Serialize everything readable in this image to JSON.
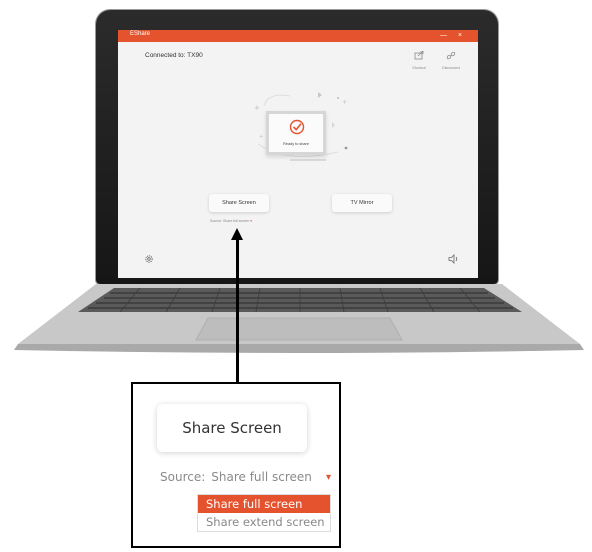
{
  "app": {
    "title": "EShare",
    "minimize": "—",
    "close": "×",
    "connected": "Connected to: TX90",
    "shortcut_label": "Shortcut",
    "disconnect_label": "Disconnect",
    "status": "Ready to share",
    "share_button": "Share Screen",
    "tv_mirror_button": "TV Mirror",
    "source_label": "Source:",
    "source_value": "Share full screen",
    "caret": "▾",
    "icons": [
      "share-export-icon",
      "unlink-icon",
      "check-circle-icon",
      "settings-icon",
      "speaker-icon"
    ]
  },
  "zoom": {
    "share_button": "Share Screen",
    "source_label": "Source:",
    "source_value": "Share full screen",
    "caret": "▾",
    "options": [
      "Share full screen",
      "Share extend screen"
    ],
    "selected_index": 0
  },
  "colors": {
    "accent": "#e5532e",
    "bezel": "#1c1c1c",
    "app_bg": "#f3f3f3"
  }
}
